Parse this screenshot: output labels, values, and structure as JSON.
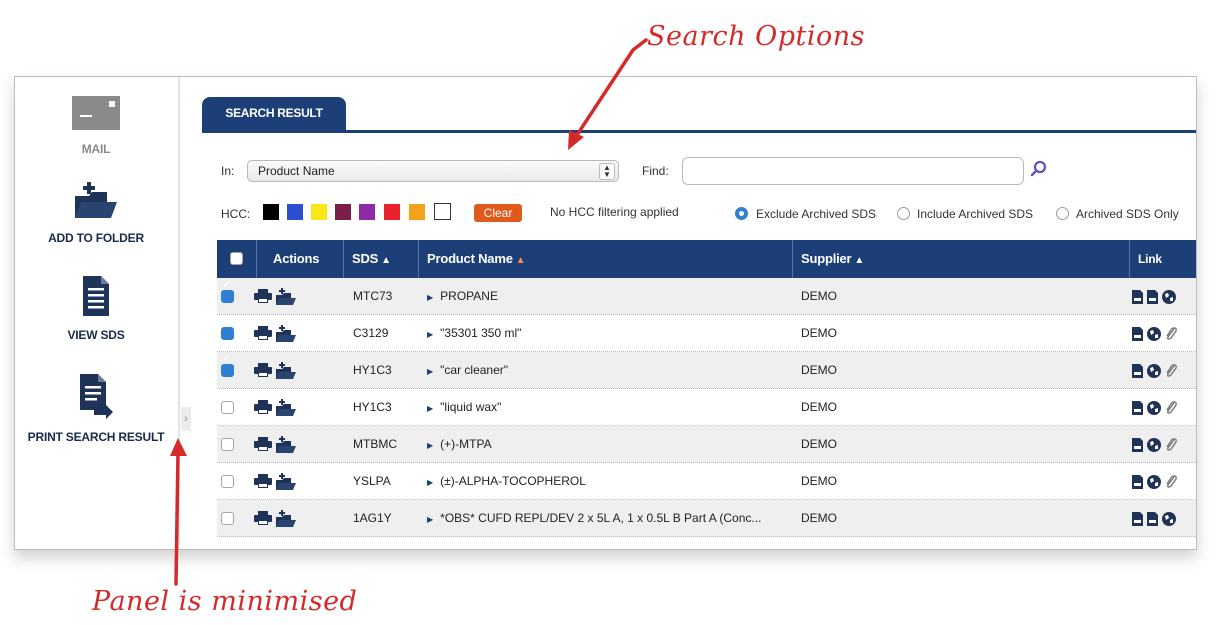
{
  "annotations": {
    "top": "Search Options",
    "bottom": "Panel is minimised"
  },
  "sidebar": {
    "items": [
      {
        "label": "MAIL",
        "icon": "mail-icon"
      },
      {
        "label": "ADD TO FOLDER",
        "icon": "add-folder-icon"
      },
      {
        "label": "VIEW SDS",
        "icon": "document-icon"
      },
      {
        "label": "PRINT SEARCH RESULT",
        "icon": "print-result-icon"
      }
    ]
  },
  "tab": {
    "label": "SEARCH RESULT"
  },
  "search": {
    "in_label": "In:",
    "in_value": "Product Name",
    "find_label": "Find:",
    "find_value": ""
  },
  "hcc": {
    "label": "HCC:",
    "colors": [
      "#000000",
      "#2c4fd0",
      "#f7e81a",
      "#7a1f4a",
      "#8d2aa8",
      "#e8222a",
      "#f5a21b",
      "#ffffff"
    ],
    "clear_label": "Clear",
    "status": "No HCC filtering applied"
  },
  "archive_options": [
    {
      "label": "Exclude Archived SDS",
      "selected": true
    },
    {
      "label": "Include Archived SDS",
      "selected": false
    },
    {
      "label": "Archived SDS Only",
      "selected": false
    }
  ],
  "table": {
    "headers": {
      "actions": "Actions",
      "sds": "SDS",
      "product": "Product Name",
      "supplier": "Supplier",
      "link": "Link"
    },
    "rows": [
      {
        "checked": true,
        "sds": "MTC73",
        "product": "PROPANE",
        "supplier": "DEMO"
      },
      {
        "checked": true,
        "sds": "C3129",
        "product": "\"35301 350 ml\"",
        "supplier": "DEMO"
      },
      {
        "checked": true,
        "sds": "HY1C3",
        "product": "\"car cleaner\"",
        "supplier": "DEMO"
      },
      {
        "checked": false,
        "sds": "HY1C3",
        "product": "\"liquid wax\"",
        "supplier": "DEMO"
      },
      {
        "checked": false,
        "sds": "MTBMC",
        "product": "(+)-MTPA",
        "supplier": "DEMO"
      },
      {
        "checked": false,
        "sds": "YSLPA",
        "product": "(±)-ALPHA-TOCOPHEROL",
        "supplier": "DEMO"
      },
      {
        "checked": false,
        "sds": "1AG1Y",
        "product": "*OBS* CUFD REPL/DEV 2 x 5L A, 1 x 0.5L B Part A (Conc...",
        "supplier": "DEMO"
      }
    ]
  }
}
